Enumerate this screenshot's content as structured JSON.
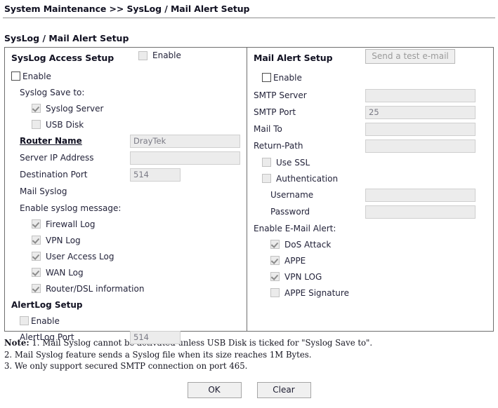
{
  "breadcrumb": "System Maintenance >> SysLog / Mail Alert Setup",
  "page_title": "SysLog / Mail Alert Setup",
  "syslog": {
    "section_title": "SysLog Access Setup",
    "enable_label": "Enable",
    "enable_checked": false,
    "save_to_label": "Syslog Save to:",
    "save_to": [
      {
        "label": "Syslog Server",
        "checked": true,
        "disabled": true
      },
      {
        "label": "USB Disk",
        "checked": false,
        "disabled": true
      }
    ],
    "router_name_label": "Router Name",
    "router_name_value": "DrayTek",
    "server_ip_label": "Server IP Address",
    "server_ip_value": "",
    "dest_port_label": "Destination Port",
    "dest_port_value": "514",
    "mail_syslog_label": "Mail Syslog",
    "mail_syslog_enable_label": "Enable",
    "mail_syslog_checked": false,
    "enable_message_label": "Enable syslog message:",
    "messages": [
      {
        "label": "Firewall Log",
        "checked": true,
        "disabled": true
      },
      {
        "label": "VPN Log",
        "checked": true,
        "disabled": true
      },
      {
        "label": "User Access Log",
        "checked": true,
        "disabled": true
      },
      {
        "label": "WAN Log",
        "checked": true,
        "disabled": true
      },
      {
        "label": "Router/DSL information",
        "checked": true,
        "disabled": true
      }
    ],
    "alertlog_title": "AlertLog Setup",
    "alertlog_enable_label": "Enable",
    "alertlog_enable_checked": false,
    "alertlog_port_label": "AlertLog Port",
    "alertlog_port_value": "514"
  },
  "mail": {
    "section_title": "Mail Alert Setup",
    "enable_label": "Enable",
    "enable_checked": false,
    "test_button_label": "Send a test e-mail",
    "smtp_server_label": "SMTP Server",
    "smtp_server_value": "",
    "smtp_port_label": "SMTP Port",
    "smtp_port_value": "25",
    "mail_to_label": "Mail To",
    "mail_to_value": "",
    "return_path_label": "Return-Path",
    "return_path_value": "",
    "use_ssl_label": "Use SSL",
    "use_ssl_checked": false,
    "authentication_label": "Authentication",
    "authentication_checked": false,
    "username_label": "Username",
    "username_value": "",
    "password_label": "Password",
    "password_value": "",
    "enable_alert_label": "Enable E-Mail Alert:",
    "alerts": [
      {
        "label": "DoS Attack",
        "checked": true,
        "disabled": true
      },
      {
        "label": "APPE",
        "checked": true,
        "disabled": true
      },
      {
        "label": "VPN LOG",
        "checked": true,
        "disabled": true
      },
      {
        "label": "APPE Signature",
        "checked": false,
        "disabled": true
      }
    ]
  },
  "notes": {
    "prefix": "Note:",
    "line1": " 1. Mail Syslog cannot be activated unless USB Disk is ticked for \"Syslog Save to\".",
    "line2": "2. Mail Syslog feature sends a Syslog file when its size reaches 1M Bytes.",
    "line3": "3. We only support secured SMTP connection on port 465."
  },
  "buttons": {
    "ok": "OK",
    "clear": "Clear"
  }
}
